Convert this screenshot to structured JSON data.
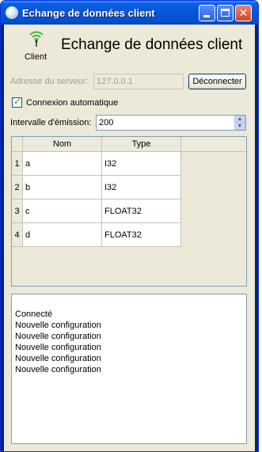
{
  "window": {
    "title": "Echange de données client"
  },
  "header": {
    "icon_label": "Client",
    "title": "Echange de données client",
    "icon": "wifi-icon"
  },
  "server": {
    "label": "Adresse du serveur:",
    "value": "127.0.0.1",
    "disconnect_label": "Déconnecter"
  },
  "auto_connect": {
    "label": "Connexion automatique",
    "checked": true
  },
  "interval": {
    "label": "Intervalle d'émission:",
    "value": "200"
  },
  "table": {
    "columns": [
      "Nom",
      "Type"
    ],
    "rows": [
      {
        "num": "1",
        "nom": "a",
        "type": "I32"
      },
      {
        "num": "2",
        "nom": "b",
        "type": "I32"
      },
      {
        "num": "3",
        "nom": "c",
        "type": "FLOAT32"
      },
      {
        "num": "4",
        "nom": "d",
        "type": "FLOAT32"
      }
    ]
  },
  "log": [
    "Connecté",
    "Nouvelle configuration",
    "Nouvelle configuration",
    "Nouvelle configuration",
    "Nouvelle configuration",
    "Nouvelle configuration"
  ]
}
